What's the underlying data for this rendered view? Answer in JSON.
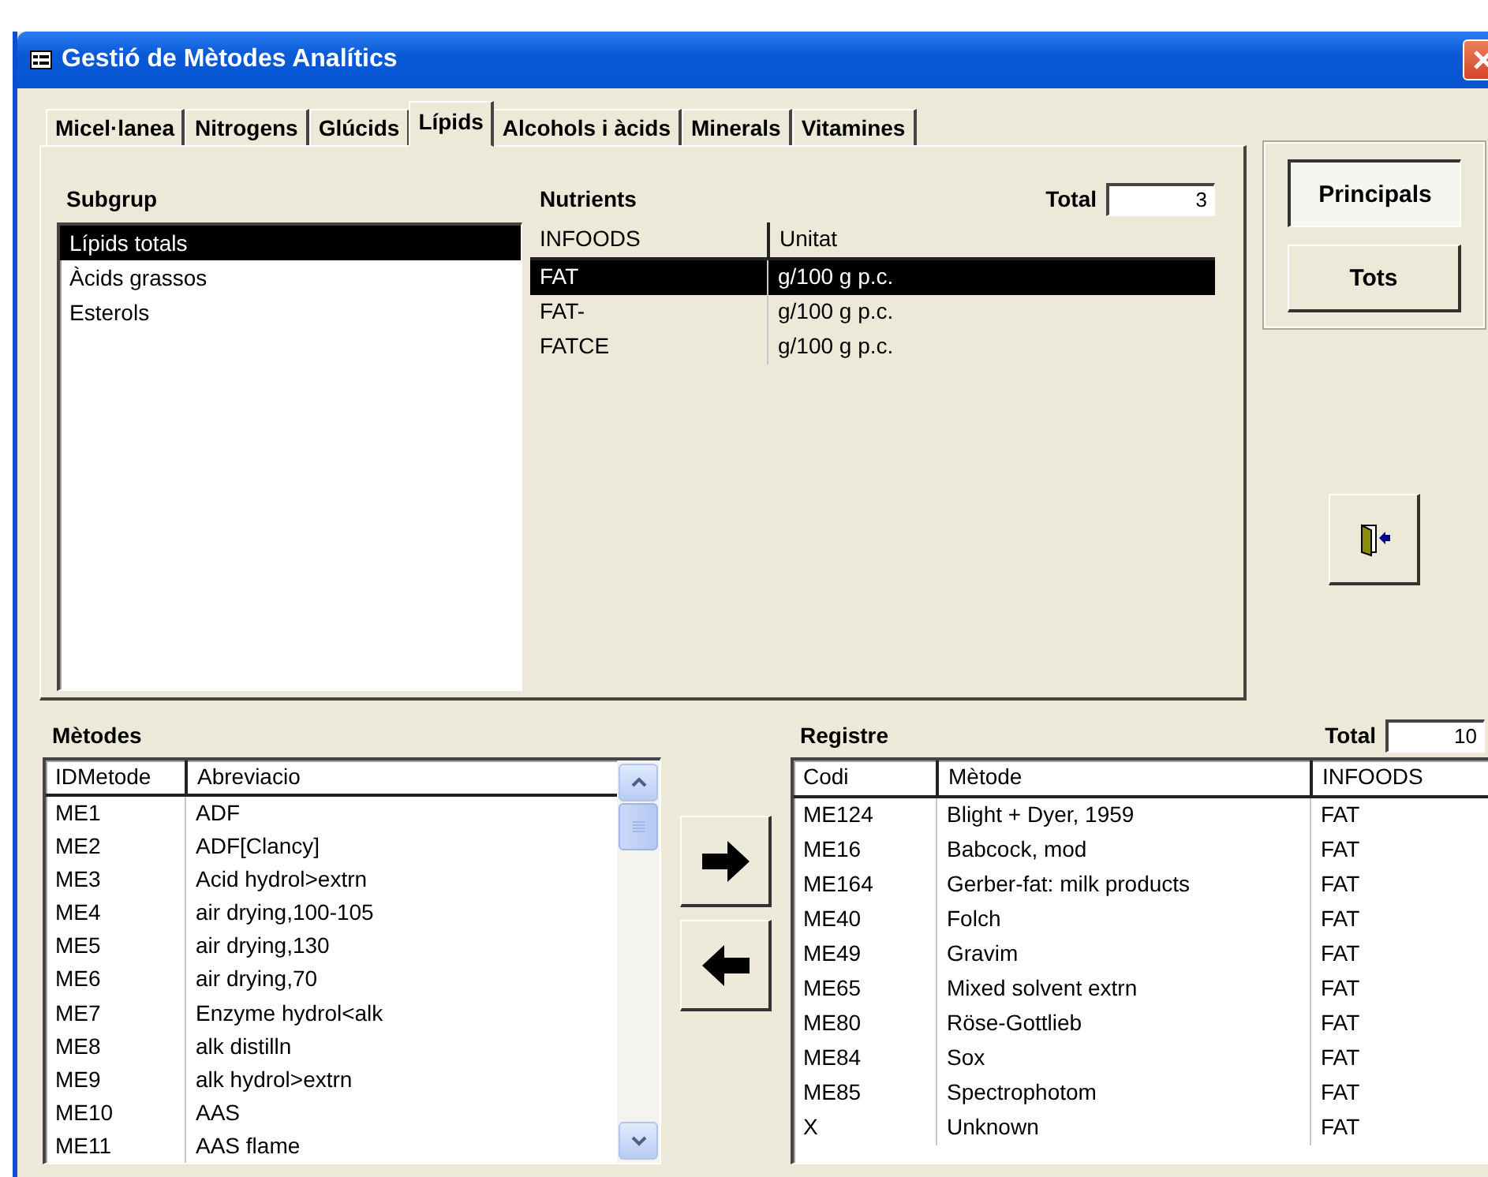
{
  "window": {
    "title": "Gestió de Mètodes Analítics"
  },
  "tabs": [
    {
      "label": "Micel·lanea",
      "selected": false
    },
    {
      "label": "Nitrogens",
      "selected": false
    },
    {
      "label": "Glúcids",
      "selected": false
    },
    {
      "label": "Lípids",
      "selected": true
    },
    {
      "label": "Alcohols i àcids",
      "selected": false
    },
    {
      "label": "Minerals",
      "selected": false
    },
    {
      "label": "Vitamines",
      "selected": false
    }
  ],
  "subgroups": {
    "title": "Subgrup",
    "items": [
      {
        "label": "Lípids totals",
        "selected": true
      },
      {
        "label": "Àcids grassos",
        "selected": false
      },
      {
        "label": "Esterols",
        "selected": false
      }
    ]
  },
  "nutrients": {
    "title": "Nutrients",
    "total_label": "Total",
    "total": "3",
    "columns": [
      "INFOODS",
      "Unitat"
    ],
    "rows": [
      {
        "cells": [
          "FAT",
          "g/100 g p.c."
        ],
        "selected": true
      },
      {
        "cells": [
          "FAT-",
          "g/100 g p.c."
        ],
        "selected": false
      },
      {
        "cells": [
          "FATCE",
          "g/100 g p.c."
        ],
        "selected": false
      }
    ]
  },
  "view_buttons": [
    {
      "label": "Principals",
      "selected": true
    },
    {
      "label": "Tots",
      "selected": false
    }
  ],
  "methods": {
    "title": "Mètodes",
    "columns": [
      "IDMetode",
      "Abreviacio"
    ],
    "rows": [
      {
        "cells": [
          "ME1",
          "ADF"
        ]
      },
      {
        "cells": [
          "ME2",
          "ADF[Clancy]"
        ]
      },
      {
        "cells": [
          "ME3",
          "Acid hydrol>extrn"
        ]
      },
      {
        "cells": [
          "ME4",
          "air drying,100-105"
        ]
      },
      {
        "cells": [
          "ME5",
          "air drying,130"
        ]
      },
      {
        "cells": [
          "ME6",
          "air drying,70"
        ]
      },
      {
        "cells": [
          "ME7",
          "Enzyme hydrol<alk"
        ]
      },
      {
        "cells": [
          "ME8",
          "alk distilln"
        ]
      },
      {
        "cells": [
          "ME9",
          "alk hydrol>extrn"
        ]
      },
      {
        "cells": [
          "ME10",
          "AAS"
        ]
      },
      {
        "cells": [
          "ME11",
          "AAS flame"
        ]
      }
    ]
  },
  "register": {
    "title": "Registre",
    "total_label": "Total",
    "total": "10",
    "columns": [
      "Codi",
      "Mètode",
      "INFOODS"
    ],
    "rows": [
      {
        "cells": [
          "ME124",
          "Blight + Dyer, 1959",
          "FAT"
        ]
      },
      {
        "cells": [
          "ME16",
          "Babcock, mod",
          "FAT"
        ]
      },
      {
        "cells": [
          "ME164",
          "Gerber-fat: milk products",
          "FAT"
        ]
      },
      {
        "cells": [
          "ME40",
          "Folch",
          "FAT"
        ]
      },
      {
        "cells": [
          "ME49",
          "Gravim",
          "FAT"
        ]
      },
      {
        "cells": [
          "ME65",
          "Mixed solvent extrn",
          "FAT"
        ]
      },
      {
        "cells": [
          "ME80",
          "Röse-Gottlieb",
          "FAT"
        ]
      },
      {
        "cells": [
          "ME84",
          "Sox",
          "FAT"
        ]
      },
      {
        "cells": [
          "ME85",
          "Spectrophotom",
          "FAT"
        ]
      },
      {
        "cells": [
          "X",
          "Unknown",
          "FAT"
        ]
      }
    ]
  }
}
